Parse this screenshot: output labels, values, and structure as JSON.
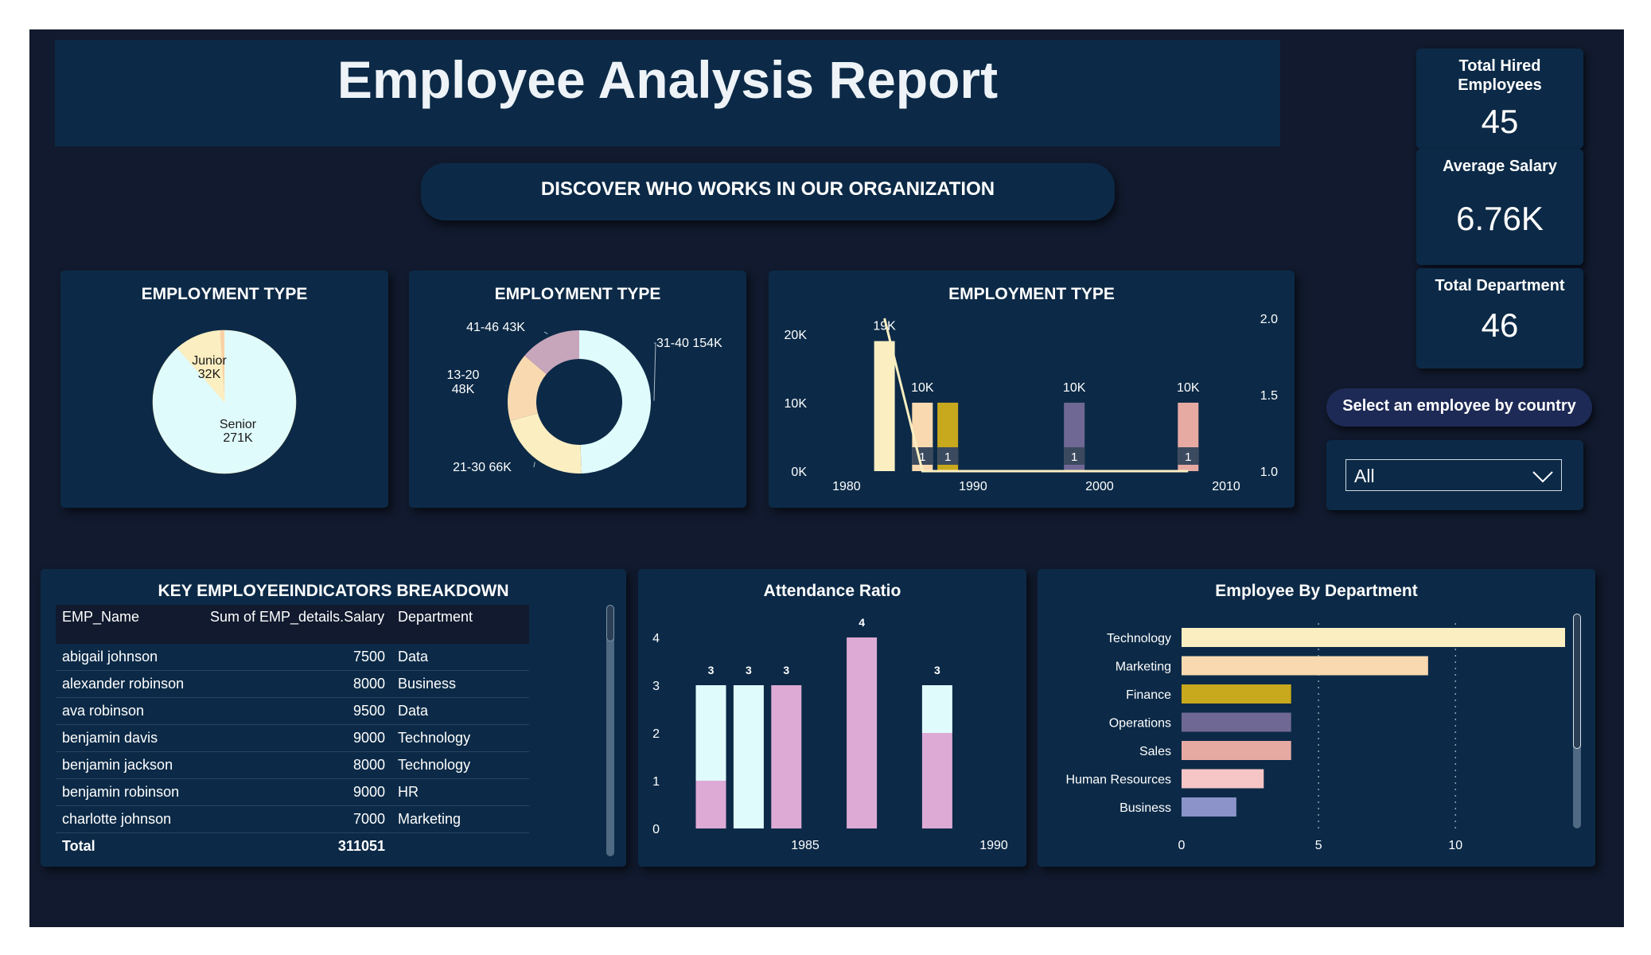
{
  "header": {
    "title": "Employee Analysis Report",
    "tagline": "DISCOVER WHO WORKS IN OUR ORGANIZATION"
  },
  "kpis": [
    {
      "label_line1": "Total Hired",
      "label_line2": "Employees",
      "value": "45"
    },
    {
      "label": "Average Salary",
      "value": "6.76K"
    },
    {
      "label": "Total Department",
      "value": "46"
    }
  ],
  "slicer": {
    "title": "Select an employee by country",
    "selected": "All"
  },
  "pie_panel": {
    "title": "EMPLOYMENT TYPE"
  },
  "donut_panel": {
    "title": "EMPLOYMENT TYPE"
  },
  "combo_panel": {
    "title": "EMPLOYMENT TYPE"
  },
  "table": {
    "title": "KEY EMPLOYEEINDICATORS BREAKDOWN",
    "columns": [
      "EMP_Name",
      "Sum of EMP_details.Salary",
      "Department"
    ],
    "rows": [
      [
        "abigail johnson",
        "7500",
        "Data"
      ],
      [
        "alexander robinson",
        "8000",
        "Business"
      ],
      [
        "ava robinson",
        "9500",
        "Data"
      ],
      [
        "benjamin davis",
        "9000",
        "Technology"
      ],
      [
        "benjamin jackson",
        "8000",
        "Technology"
      ],
      [
        "benjamin robinson",
        "9000",
        "HR"
      ],
      [
        "charlotte johnson",
        "7000",
        "Marketing"
      ]
    ],
    "total_label": "Total",
    "total_value": "311051"
  },
  "attendance_panel": {
    "title": "Attendance Ratio"
  },
  "department_panel": {
    "title": "Employee By Department"
  },
  "chart_data": [
    {
      "type": "pie",
      "title": "EMPLOYMENT TYPE",
      "slices": [
        {
          "label": "Senior",
          "value": 271,
          "display": "271K",
          "color": "#e0fbfc"
        },
        {
          "label": "Junior",
          "value": 32,
          "display": "32K",
          "color": "#fbeec1"
        },
        {
          "label": "",
          "value": 3,
          "display": "",
          "color": "#f9cfa4"
        }
      ]
    },
    {
      "type": "pie",
      "title": "EMPLOYMENT TYPE",
      "donut": true,
      "slices": [
        {
          "label": "31-40",
          "value": 154,
          "display": "154K",
          "color": "#e0fbfc"
        },
        {
          "label": "21-30",
          "value": 66,
          "display": "66K",
          "color": "#fbeec1"
        },
        {
          "label": "13-20",
          "value": 48,
          "display": "48K",
          "color": "#f9d9b0"
        },
        {
          "label": "41-46",
          "value": 43,
          "display": "43K",
          "color": "#c7a6bb"
        }
      ]
    },
    {
      "type": "bar",
      "title": "EMPLOYMENT TYPE",
      "x_ticks": [
        1980,
        1990,
        2000,
        2010
      ],
      "xlim": [
        1979,
        2010
      ],
      "y_ticks": [
        "0K",
        "10K",
        "20K"
      ],
      "ylim": [
        0,
        20000
      ],
      "y2_ticks": [
        "1.0",
        "1.5",
        "2.0"
      ],
      "y2lim": [
        1.0,
        2.0
      ],
      "bars": [
        {
          "x": 1983,
          "value": 19000,
          "label": "19K",
          "color": "#fbeec1",
          "count": ""
        },
        {
          "x": 1986,
          "value": 10000,
          "label": "10K",
          "color": "#f9d9b0",
          "count": "1"
        },
        {
          "x": 1988,
          "value": 10000,
          "label": "",
          "color": "#c8a81c",
          "count": "1"
        },
        {
          "x": 1998,
          "value": 10000,
          "label": "10K",
          "color": "#6f6894",
          "count": "1"
        },
        {
          "x": 2007,
          "value": 10000,
          "label": "10K",
          "color": "#e6aaa3",
          "count": "1"
        }
      ],
      "line": {
        "x": [
          1983,
          1986,
          1988,
          1998,
          2007
        ],
        "y": [
          2.0,
          1.0,
          1.0,
          1.0,
          1.0
        ],
        "color": "#fbeec1"
      }
    },
    {
      "type": "bar",
      "title": "Attendance Ratio",
      "stacked": true,
      "x_ticks": [
        1985,
        1990
      ],
      "y_ticks": [
        0,
        1,
        2,
        3,
        4
      ],
      "ylim": [
        0,
        4
      ],
      "series_colors": [
        "#ddaad6",
        "#e0fbfc"
      ],
      "bars": [
        {
          "x": 1982.5,
          "total": 3,
          "segments": [
            1,
            2
          ]
        },
        {
          "x": 1983.5,
          "total": 3,
          "segments": [
            0,
            3
          ]
        },
        {
          "x": 1984.5,
          "total": 3,
          "segments": [
            3,
            0
          ]
        },
        {
          "x": 1986.5,
          "total": 4,
          "segments": [
            4,
            0
          ]
        },
        {
          "x": 1988.5,
          "total": 3,
          "segments": [
            2,
            1
          ]
        }
      ]
    },
    {
      "type": "bar",
      "orientation": "horizontal",
      "title": "Employee By Department",
      "categories": [
        "Technology",
        "Marketing",
        "Finance",
        "Operations",
        "Sales",
        "Human Resources",
        "Business"
      ],
      "values": [
        14,
        9,
        4,
        4,
        4,
        3,
        2
      ],
      "colors": [
        "#fbeec1",
        "#f9d9b0",
        "#c8a81c",
        "#6f6894",
        "#e6aaa3",
        "#f6c5c5",
        "#8b93c9"
      ],
      "x_ticks": [
        0,
        5,
        10
      ],
      "xlim": [
        0,
        14
      ],
      "grid": true
    }
  ]
}
